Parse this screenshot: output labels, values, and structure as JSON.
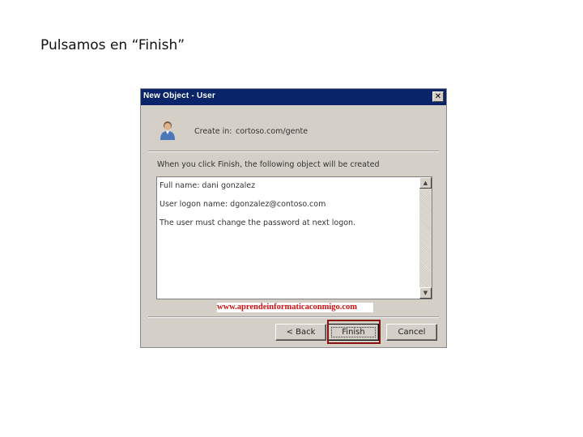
{
  "caption": "Pulsamos en “Finish”",
  "dialog": {
    "title": "New Object - User",
    "close_glyph": "✕",
    "create_in_label": "Create in:",
    "create_in_value": "cortoso.com/gente",
    "info_text": "When you click Finish, the following object will be created",
    "summary_lines": [
      "Full name: dani gonzalez",
      "User logon name: dgonzalez@contoso.com",
      "The user must change the password at next logon."
    ],
    "scroll_up": "▲",
    "scroll_down": "▼",
    "watermark": "www.aprendeinformaticaconmigo.com",
    "buttons": {
      "back": "< Back",
      "finish": "Finish",
      "cancel": "Cancel"
    },
    "icon": "user-icon"
  },
  "colors": {
    "titlebar": "#0a246a",
    "dialog_bg": "#d4d0c8",
    "highlight": "#8b1010",
    "watermark": "#cc1111"
  }
}
